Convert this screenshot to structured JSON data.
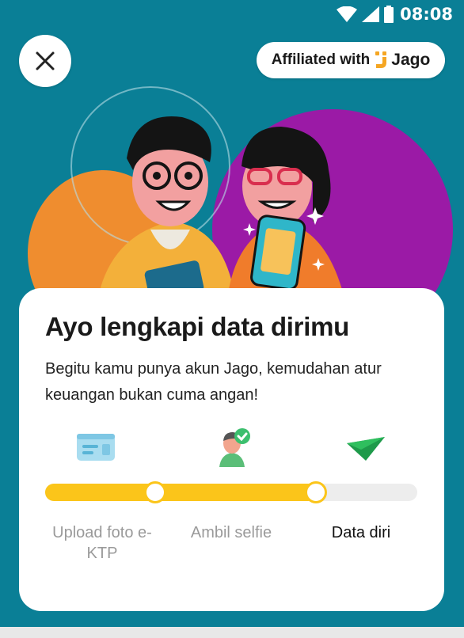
{
  "status_bar": {
    "time": "08:08"
  },
  "header": {
    "affiliate_text": "Affiliated with",
    "brand_name": "Jago",
    "brand_color": "#F5A623"
  },
  "card": {
    "title": "Ayo lengkapi data dirimu",
    "subtitle": "Begitu kamu punya akun Jago, kemudahan atur keuangan bukan cuma angan!",
    "steps": [
      {
        "label": "Upload foto e-KTP",
        "icon": "id-card-icon",
        "state": "done"
      },
      {
        "label": "Ambil selfie",
        "icon": "selfie-icon",
        "state": "done"
      },
      {
        "label": "Data diri",
        "icon": "paper-plane-icon",
        "state": "current"
      }
    ],
    "progress_fraction": 0.73
  },
  "colors": {
    "background": "#0A7F96",
    "accent": "#FBC51A",
    "purple": "#9B1AA6",
    "orange": "#EF8D2F"
  }
}
